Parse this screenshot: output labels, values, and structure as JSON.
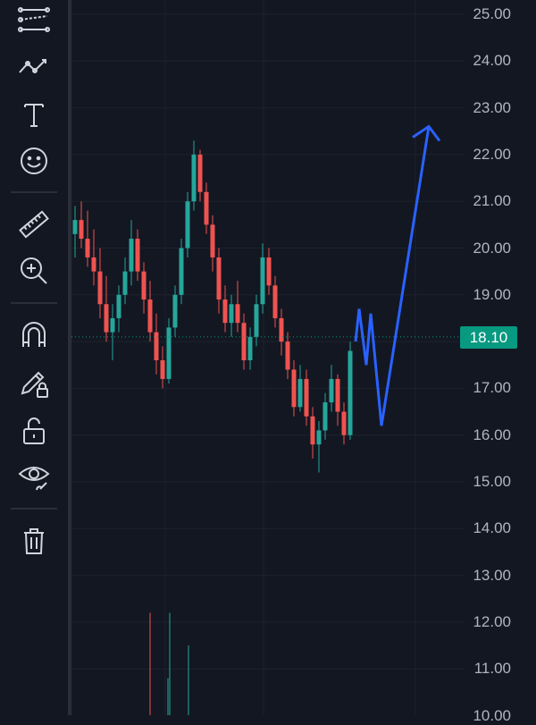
{
  "toolbar": {
    "tools": [
      {
        "name": "multi-line-tool-icon"
      },
      {
        "name": "trend-line-tool-icon"
      },
      {
        "name": "text-tool-icon"
      },
      {
        "name": "emoji-icon"
      },
      {
        "name": "ruler-icon"
      },
      {
        "name": "zoom-in-icon"
      },
      {
        "name": "magnet-icon"
      },
      {
        "name": "lock-drawing-icon"
      },
      {
        "name": "unlock-icon"
      },
      {
        "name": "eye-paint-icon"
      },
      {
        "name": "trash-icon"
      }
    ]
  },
  "price_axis": {
    "labels": [
      "25.00",
      "24.00",
      "23.00",
      "22.00",
      "21.00",
      "20.00",
      "19.00",
      "18.00",
      "17.00",
      "16.00",
      "15.00",
      "14.00",
      "13.00",
      "12.00",
      "11.00",
      "10.00"
    ],
    "current_price": "18.10",
    "current_price_color": "#089981"
  },
  "colors": {
    "background": "#131722",
    "up_candle": "#26a69a",
    "down_candle": "#ef5350",
    "drawing": "#2962ff",
    "grid": "#1e222d"
  },
  "chart_data": {
    "type": "candlestick",
    "ylim": [
      10,
      25
    ],
    "current_price": 18.1,
    "ohlc": [
      [
        20.3,
        20.9,
        19.8,
        20.6
      ],
      [
        20.6,
        21.0,
        20.0,
        20.2
      ],
      [
        20.2,
        20.8,
        19.6,
        19.8
      ],
      [
        19.8,
        20.4,
        19.2,
        19.5
      ],
      [
        19.5,
        20.0,
        18.5,
        18.8
      ],
      [
        18.8,
        19.4,
        18.0,
        18.2
      ],
      [
        18.2,
        18.8,
        17.6,
        18.5
      ],
      [
        18.5,
        19.2,
        18.2,
        19.0
      ],
      [
        19.0,
        19.8,
        18.8,
        19.5
      ],
      [
        19.5,
        20.6,
        19.2,
        20.2
      ],
      [
        20.2,
        20.4,
        19.3,
        19.5
      ],
      [
        19.5,
        19.7,
        18.6,
        18.9
      ],
      [
        18.9,
        19.3,
        18.0,
        18.2
      ],
      [
        18.2,
        18.6,
        17.3,
        17.6
      ],
      [
        17.6,
        17.9,
        17.0,
        17.2
      ],
      [
        17.2,
        18.5,
        17.1,
        18.3
      ],
      [
        18.3,
        19.2,
        18.1,
        19.0
      ],
      [
        19.0,
        20.2,
        18.8,
        20.0
      ],
      [
        20.0,
        21.2,
        19.8,
        21.0
      ],
      [
        21.0,
        22.3,
        20.8,
        22.0
      ],
      [
        22.0,
        22.1,
        21.0,
        21.2
      ],
      [
        21.2,
        21.4,
        20.3,
        20.5
      ],
      [
        20.5,
        20.7,
        19.5,
        19.8
      ],
      [
        19.8,
        20.0,
        18.6,
        18.9
      ],
      [
        18.9,
        19.2,
        18.2,
        18.4
      ],
      [
        18.4,
        19.0,
        18.1,
        18.8
      ],
      [
        18.8,
        19.3,
        18.2,
        18.4
      ],
      [
        18.4,
        18.6,
        17.4,
        17.6
      ],
      [
        17.6,
        18.3,
        17.4,
        18.1
      ],
      [
        18.1,
        19.0,
        17.9,
        18.8
      ],
      [
        18.8,
        20.1,
        18.6,
        19.8
      ],
      [
        19.8,
        20.0,
        19.0,
        19.2
      ],
      [
        19.2,
        19.4,
        18.3,
        18.5
      ],
      [
        18.5,
        18.7,
        17.7,
        18.0
      ],
      [
        18.0,
        18.2,
        17.2,
        17.4
      ],
      [
        17.4,
        17.6,
        16.4,
        16.6
      ],
      [
        16.6,
        17.5,
        16.5,
        17.2
      ],
      [
        17.2,
        17.4,
        16.2,
        16.4
      ],
      [
        16.4,
        16.6,
        15.5,
        15.8
      ],
      [
        15.8,
        16.3,
        15.2,
        16.1
      ],
      [
        16.1,
        16.9,
        15.9,
        16.7
      ],
      [
        16.7,
        17.5,
        16.5,
        17.2
      ],
      [
        17.2,
        17.3,
        16.2,
        16.5
      ],
      [
        16.5,
        16.7,
        15.8,
        16.0
      ],
      [
        16.0,
        18.0,
        15.9,
        17.8
      ]
    ],
    "drawing_path_prices": [
      18.0,
      18.7,
      17.5,
      18.6,
      16.2,
      22.6
    ],
    "volume_bars": [
      12.2,
      12.2,
      10.8,
      11.5,
      10.0
    ]
  }
}
